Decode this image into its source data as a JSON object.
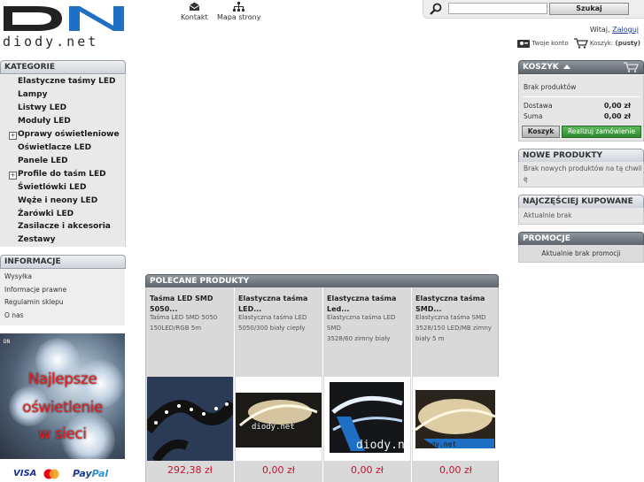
{
  "header": {
    "logo_word": "diody.net",
    "nav": [
      {
        "label": "Kontakt",
        "icon": "envelope-icon"
      },
      {
        "label": "Mapa strony",
        "icon": "sitemap-icon"
      }
    ],
    "search": {
      "placeholder": "",
      "button": "Szukaj"
    },
    "welcome_text": "Witaj,",
    "login_link": "Zaloguj",
    "account_label": "Twoje konto",
    "cart_label": "Koszyk:",
    "cart_status": "(pusty)"
  },
  "categories": {
    "title": "KATEGORIE",
    "items": [
      {
        "label": "Elastyczne taśmy LED",
        "expandable": false
      },
      {
        "label": "Lampy",
        "expandable": false
      },
      {
        "label": "Listwy LED",
        "expandable": false
      },
      {
        "label": "Moduły LED",
        "expandable": false
      },
      {
        "label": "Oprawy oświetleniowe",
        "expandable": true
      },
      {
        "label": "Oświetlacze LED",
        "expandable": false
      },
      {
        "label": "Panele LED",
        "expandable": false
      },
      {
        "label": "Profile do taśm LED",
        "expandable": true
      },
      {
        "label": "Świetlówki LED",
        "expandable": false
      },
      {
        "label": "Węże i neony LED",
        "expandable": false
      },
      {
        "label": "Żarówki LED",
        "expandable": false
      },
      {
        "label": "Zasilacze i akcesoria",
        "expandable": false
      },
      {
        "label": "Zestawy",
        "expandable": false
      }
    ]
  },
  "info": {
    "title": "INFORMACJE",
    "items": [
      "Wysyłka",
      "Informacje prawne",
      "Regulamin sklepu",
      "O nas"
    ]
  },
  "banner": {
    "lines": [
      "Najlepsze",
      "oświetlenie",
      "w sieci"
    ],
    "mini_logo": "DN"
  },
  "payments": {
    "visa": "VISA",
    "paypal_a": "Pay",
    "paypal_b": "Pal"
  },
  "cart": {
    "title": "KOSZYK",
    "empty_text": "Brak produktów",
    "delivery_label": "Dostawa",
    "delivery_value": "0,00 zł",
    "sum_label": "Suma",
    "sum_value": "0,00 zł",
    "cart_button": "Koszyk",
    "order_button": "Realizuj zamówienie"
  },
  "new_products": {
    "title": "NOWE PRODUKTY",
    "text_1": "Brak nowych produktów na tą chwil",
    "text_2": "ę"
  },
  "bestsellers": {
    "title": "NAJCZĘŚCIEJ KUPOWANE",
    "text": "Aktualnie brak"
  },
  "promotions": {
    "title": "PROMOCJE",
    "text": "Aktualnie brak promocji"
  },
  "featured": {
    "title": "POLECANE PRODUKTY",
    "products": [
      {
        "name_1": "Taśma LED SMD 5050...",
        "name_2": "",
        "desc": [
          "Taśma LED SMD 5050",
          "150LED/RGB 5m"
        ],
        "price": "292,38 zł"
      },
      {
        "name_1": "Elastyczna taśma",
        "name_2": "LED...",
        "desc": [
          "Elastyczna taśma LED",
          "5050/300 biały ciepły"
        ],
        "price": "0,00 zł"
      },
      {
        "name_1": "Elastyczna taśma",
        "name_2": "Led...",
        "desc": [
          "Elastyczna taśma LED SMD",
          "3528/60 zimny biały"
        ],
        "price": "0,00 zł"
      },
      {
        "name_1": "Elastyczna taśma",
        "name_2": "SMD...",
        "desc": [
          "Elastyczna taśma SMD",
          "3528/150 LED/MB zimny",
          "biały 5 m"
        ],
        "price": "0,00 zł"
      }
    ],
    "watermark": "diody.net"
  },
  "colors": {
    "price": "#c4122f",
    "order_button": "#3a9a3a",
    "logo": "#2a2a2a",
    "banner_text": "#e52224"
  }
}
